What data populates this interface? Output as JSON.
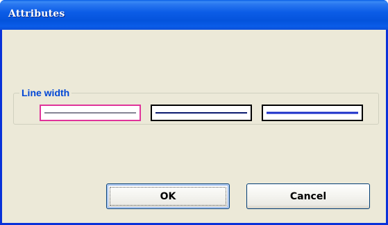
{
  "window": {
    "title": "Attributes"
  },
  "line_width": {
    "label": "Line width",
    "options": [
      {
        "id": "thin",
        "border_color": "#e0339a",
        "line_color": "#0a0a2a",
        "selected": true
      },
      {
        "id": "medium",
        "border_color": "#000000",
        "line_color": "#0a1a6e",
        "selected": false
      },
      {
        "id": "thick",
        "border_color": "#000000",
        "line_color": "#1a2ec8",
        "selected": false
      }
    ]
  },
  "buttons": {
    "ok_label": "OK",
    "cancel_label": "Cancel"
  },
  "colors": {
    "titlebar": "#0a5ce8",
    "dialog_background": "#ece9d8",
    "group_label": "#0046d5",
    "selection_border": "#e0339a"
  }
}
